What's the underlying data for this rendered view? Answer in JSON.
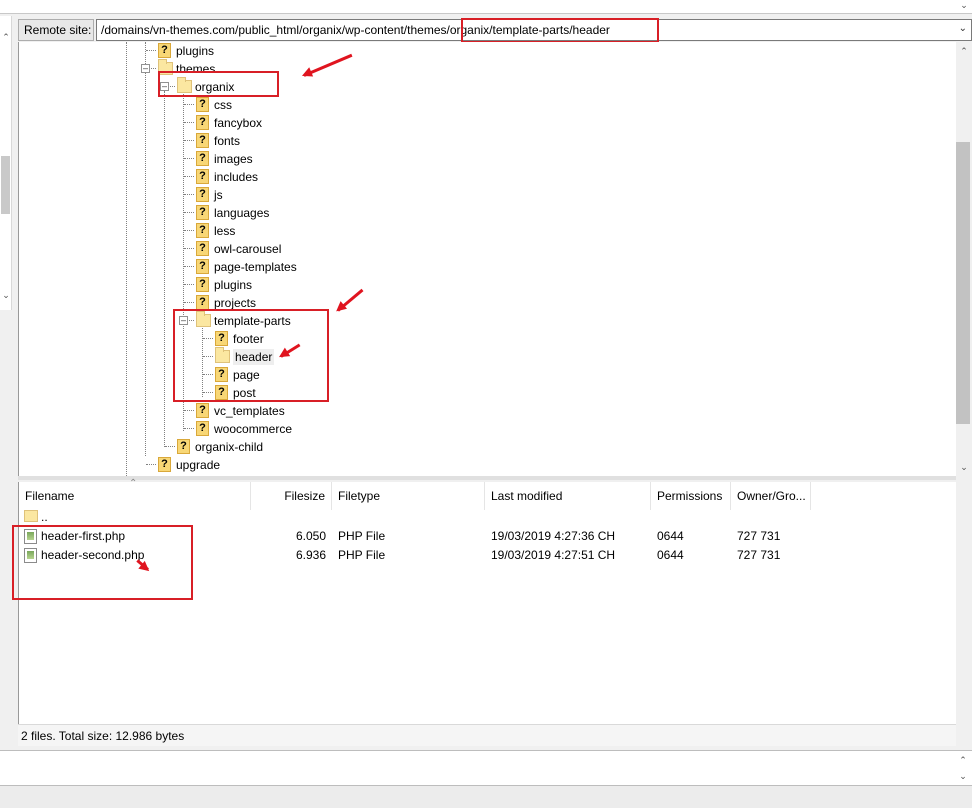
{
  "remote_site": {
    "label": "Remote site:",
    "path": "/domains/vn-themes.com/public_html/organix/wp-content/themes/organix/template-parts/header"
  },
  "tree": [
    {
      "label": "plugins",
      "icon": "question-folder-icon"
    },
    {
      "label": "themes",
      "icon": "folder-icon"
    },
    {
      "label": "organix",
      "icon": "folder-icon"
    },
    {
      "label": "css",
      "icon": "question-folder-icon"
    },
    {
      "label": "fancybox",
      "icon": "question-folder-icon"
    },
    {
      "label": "fonts",
      "icon": "question-folder-icon"
    },
    {
      "label": "images",
      "icon": "question-folder-icon"
    },
    {
      "label": "includes",
      "icon": "question-folder-icon"
    },
    {
      "label": "js",
      "icon": "question-folder-icon"
    },
    {
      "label": "languages",
      "icon": "question-folder-icon"
    },
    {
      "label": "less",
      "icon": "question-folder-icon"
    },
    {
      "label": "owl-carousel",
      "icon": "question-folder-icon"
    },
    {
      "label": "page-templates",
      "icon": "question-folder-icon"
    },
    {
      "label": "plugins",
      "icon": "question-folder-icon"
    },
    {
      "label": "projects",
      "icon": "question-folder-icon"
    },
    {
      "label": "template-parts",
      "icon": "folder-icon"
    },
    {
      "label": "footer",
      "icon": "question-folder-icon"
    },
    {
      "label": "header",
      "icon": "folder-icon"
    },
    {
      "label": "page",
      "icon": "question-folder-icon"
    },
    {
      "label": "post",
      "icon": "question-folder-icon"
    },
    {
      "label": "vc_templates",
      "icon": "question-folder-icon"
    },
    {
      "label": "woocommerce",
      "icon": "question-folder-icon"
    },
    {
      "label": "organix-child",
      "icon": "question-folder-icon"
    },
    {
      "label": "upgrade",
      "icon": "question-folder-icon"
    }
  ],
  "file_list": {
    "columns": [
      "Filename",
      "Filesize",
      "Filetype",
      "Last modified",
      "Permissions",
      "Owner/Gro..."
    ],
    "rows": [
      {
        "name": "..",
        "size": "",
        "type": "",
        "modified": "",
        "permissions": "",
        "owner": ""
      },
      {
        "name": "header-first.php",
        "size": "6.050",
        "type": "PHP File",
        "modified": "19/03/2019 4:27:36 CH",
        "permissions": "0644",
        "owner": "727 731"
      },
      {
        "name": "header-second.php",
        "size": "6.936",
        "type": "PHP File",
        "modified": "19/03/2019 4:27:51 CH",
        "permissions": "0644",
        "owner": "727 731"
      }
    ],
    "status": "2 files. Total size: 12.986 bytes"
  },
  "colors": {
    "highlight_red": "#d81f26",
    "folder_yellow": "#fbe7a1",
    "question_yellow": "#f8d776"
  }
}
